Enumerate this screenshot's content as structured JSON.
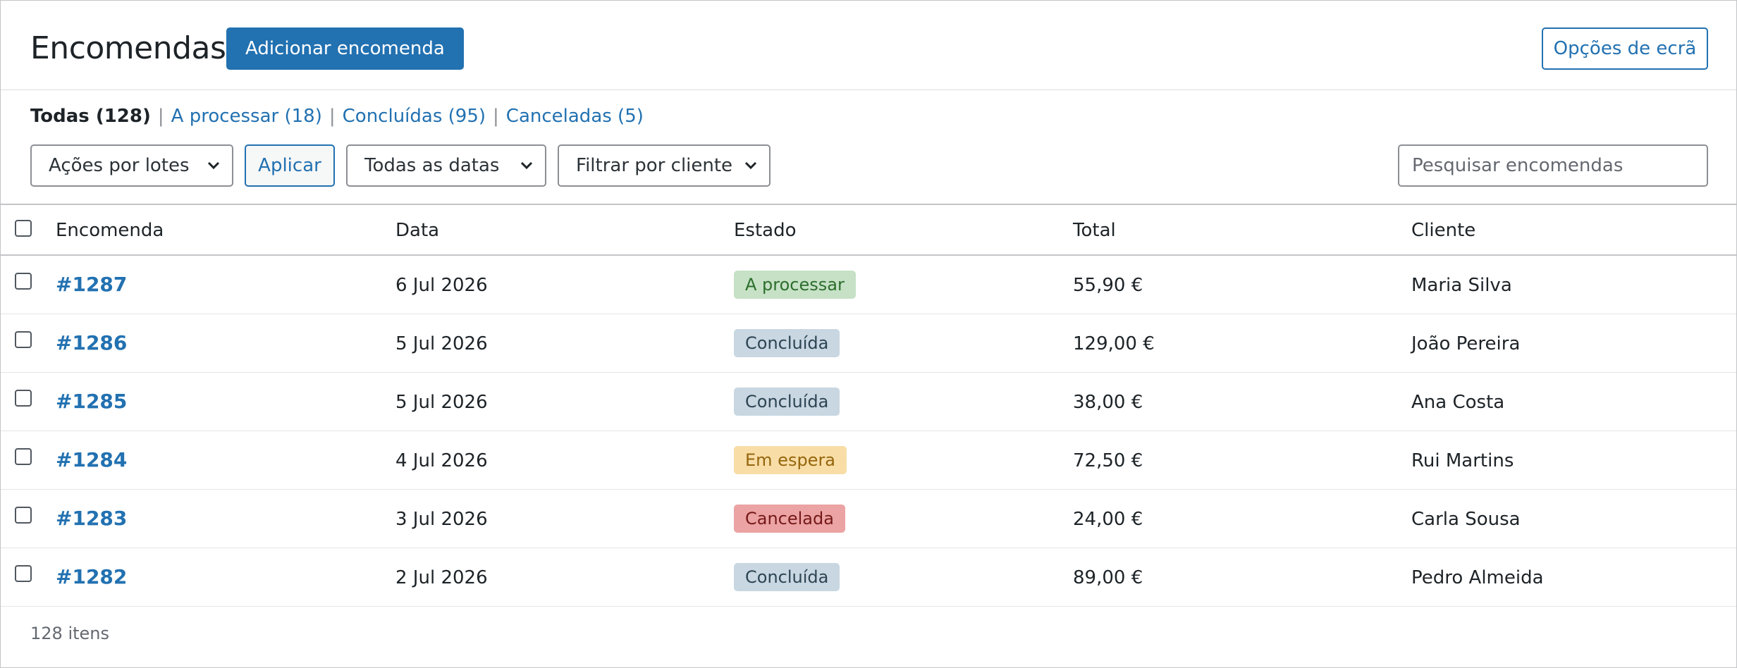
{
  "header": {
    "title": "Encomendas",
    "add_button": "Adicionar encomenda",
    "screen_options": "Opções de ecrã"
  },
  "filters": {
    "views": [
      {
        "label": "Todas (128)",
        "current": true
      },
      {
        "label": "A processar (18)",
        "current": false
      },
      {
        "label": "Concluídas (95)",
        "current": false
      },
      {
        "label": "Canceladas (5)",
        "current": false
      }
    ],
    "separator": "|",
    "bulk_actions": "Ações por lotes",
    "apply": "Aplicar",
    "dates": "Todas as datas",
    "customer": "Filtrar por cliente",
    "search_placeholder": "Pesquisar encomendas"
  },
  "table": {
    "columns": {
      "order": "Encomenda",
      "date": "Data",
      "status": "Estado",
      "total": "Total",
      "customer": "Cliente"
    },
    "rows": [
      {
        "order": "#1287",
        "date": "6 Jul 2026",
        "status": "A processar",
        "total": "55,90 €",
        "customer": "Maria Silva"
      },
      {
        "order": "#1286",
        "date": "5 Jul 2026",
        "status": "Concluída",
        "total": "129,00 €",
        "customer": "João Pereira"
      },
      {
        "order": "#1285",
        "date": "5 Jul 2026",
        "status": "Concluída",
        "total": "38,00 €",
        "customer": "Ana Costa"
      },
      {
        "order": "#1284",
        "date": "4 Jul 2026",
        "status": "Em espera",
        "total": "72,50 €",
        "customer": "Rui Martins"
      },
      {
        "order": "#1283",
        "date": "3 Jul 2026",
        "status": "Cancelada",
        "total": "24,00 €",
        "customer": "Carla Sousa"
      },
      {
        "order": "#1282",
        "date": "2 Jul 2026",
        "status": "Concluída",
        "total": "89,00 €",
        "customer": "Pedro Almeida"
      }
    ]
  },
  "status_colors": {
    "A processar": {
      "bg": "#c6e1c6",
      "fg": "#2c6e2c"
    },
    "Concluída": {
      "bg": "#c8d7e1",
      "fg": "#2e4453"
    },
    "Em espera": {
      "bg": "#f8dda7",
      "fg": "#94660c"
    },
    "Cancelada": {
      "bg": "#eba3a3",
      "fg": "#761919"
    }
  },
  "footer": {
    "item_count": "128 itens"
  }
}
